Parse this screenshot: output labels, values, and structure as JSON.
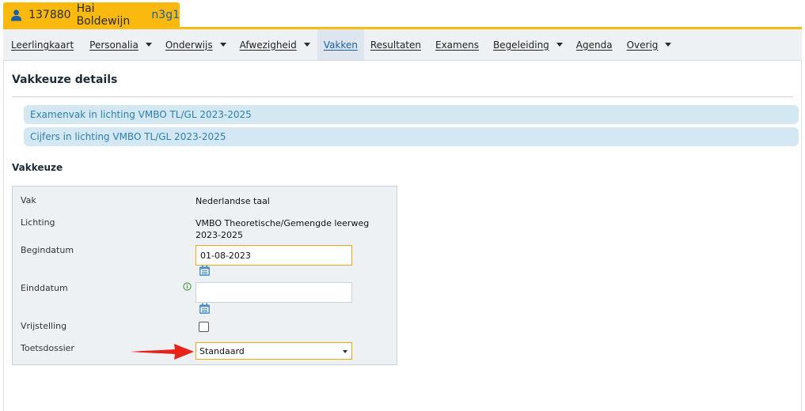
{
  "student": {
    "number": "137880",
    "name": "Hai Boldewijn",
    "klas": "n3g1",
    "icon": "person-icon"
  },
  "nav": {
    "items": [
      {
        "label": "Leerlingkaart",
        "dropdown": false
      },
      {
        "label": "Personalia",
        "dropdown": true
      },
      {
        "label": "Onderwijs",
        "dropdown": true
      },
      {
        "label": "Afwezigheid",
        "dropdown": true
      },
      {
        "label": "Vakken",
        "dropdown": false,
        "active": true
      },
      {
        "label": "Resultaten",
        "dropdown": false
      },
      {
        "label": "Examens",
        "dropdown": false
      },
      {
        "label": "Begeleiding",
        "dropdown": true
      },
      {
        "label": "Agenda",
        "dropdown": false
      },
      {
        "label": "Overig",
        "dropdown": true
      }
    ]
  },
  "page": {
    "title": "Vakkeuze details",
    "links": [
      "Examenvak in lichting VMBO TL/GL 2023-2025",
      "Cijfers in lichting VMBO TL/GL 2023-2025"
    ],
    "section_title": "Vakkeuze"
  },
  "form": {
    "vak": {
      "label": "Vak",
      "value": "Nederlandse taal"
    },
    "lichting": {
      "label": "Lichting",
      "value_line1": "VMBO Theoretische/Gemengde leerweg",
      "value_line2": "2023-2025"
    },
    "begindatum": {
      "label": "Begindatum",
      "value": "01-08-2023"
    },
    "einddatum": {
      "label": "Einddatum",
      "value": ""
    },
    "vrijstelling": {
      "label": "Vrijstelling",
      "checked": false
    },
    "toetsdossier": {
      "label": "Toetsdossier",
      "value": "Standaard"
    }
  },
  "colors": {
    "accent": "#f9b90f",
    "link": "#2e7fa8",
    "link_bg": "#d3e8f3",
    "annotation_arrow": "#e8221b"
  }
}
